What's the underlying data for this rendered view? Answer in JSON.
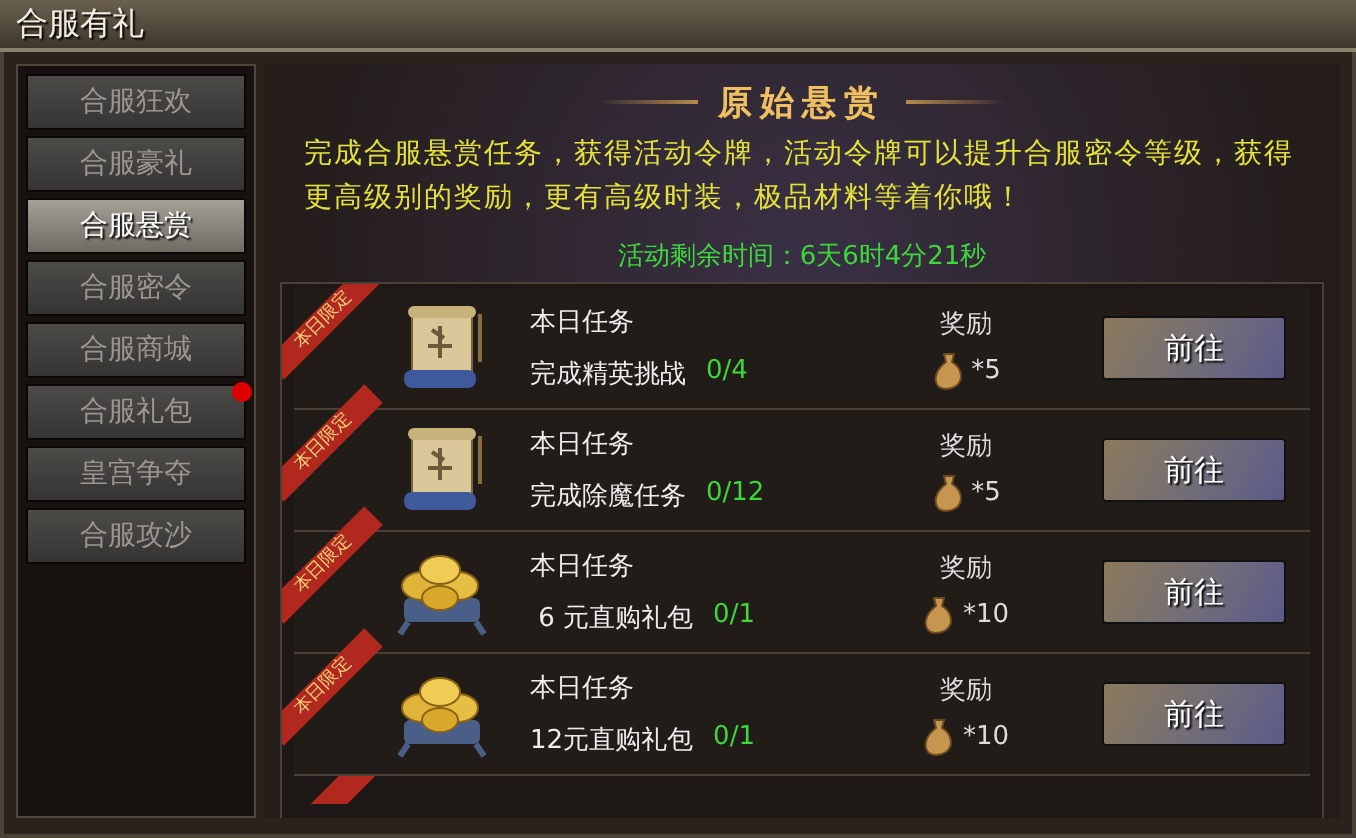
{
  "window": {
    "title": "合服有礼"
  },
  "tabs": [
    {
      "label": "合服狂欢",
      "selected": false,
      "badge": false
    },
    {
      "label": "合服豪礼",
      "selected": false,
      "badge": false
    },
    {
      "label": "合服悬赏",
      "selected": true,
      "badge": false
    },
    {
      "label": "合服密令",
      "selected": false,
      "badge": false
    },
    {
      "label": "合服商城",
      "selected": false,
      "badge": false
    },
    {
      "label": "合服礼包",
      "selected": false,
      "badge": true
    },
    {
      "label": "皇宫争夺",
      "selected": false,
      "badge": false
    },
    {
      "label": "合服攻沙",
      "selected": false,
      "badge": false
    }
  ],
  "panel": {
    "heading": "原始悬赏",
    "description": "完成合服悬赏任务，获得活动令牌，活动令牌可以提升合服密令等级，获得更高级别的奖励，更有高级时装，极品材料等着你哦！",
    "countdown": "活动剩余时间：6天6时4分21秒"
  },
  "tasks": [
    {
      "ribbon": "本日限定",
      "kind": "scroll",
      "title": "本日任务",
      "name": "完成精英挑战",
      "progress": "0/4",
      "done": false,
      "reward_label": "奖励",
      "reward_count": "*5",
      "button": "前往"
    },
    {
      "ribbon": "本日限定",
      "kind": "scroll",
      "title": "本日任务",
      "name": "完成除魔任务",
      "progress": "0/12",
      "done": false,
      "reward_label": "奖励",
      "reward_count": "*5",
      "button": "前往"
    },
    {
      "ribbon": "本日限定",
      "kind": "ingots",
      "title": "本日任务",
      "name": " 6 元直购礼包",
      "progress": "0/1",
      "done": false,
      "reward_label": "奖励",
      "reward_count": "*10",
      "button": "前往"
    },
    {
      "ribbon": "本日限定",
      "kind": "ingots",
      "title": "本日任务",
      "name": "12元直购礼包",
      "progress": "0/1",
      "done": false,
      "reward_label": "奖励",
      "reward_count": "*10",
      "button": "前往"
    }
  ]
}
